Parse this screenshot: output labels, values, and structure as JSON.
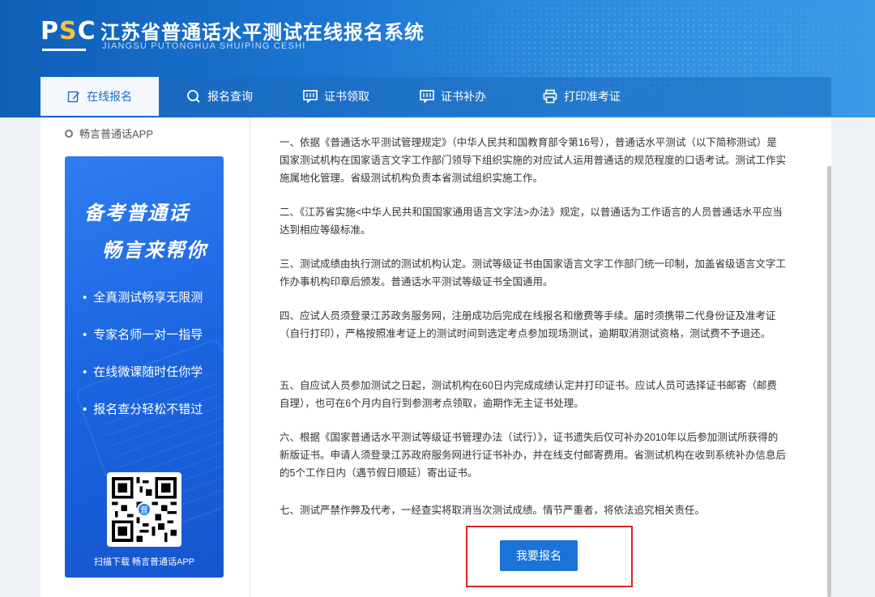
{
  "header": {
    "logo_text": "PSC",
    "title": "江苏省普通话水平测试在线报名系统",
    "subtitle": "JIANGSU PUTONGHUA SHUIPING CESHI"
  },
  "nav": {
    "items": [
      {
        "label": "在线报名",
        "icon": "edit-icon",
        "active": true
      },
      {
        "label": "报名查询",
        "icon": "search-icon",
        "active": false
      },
      {
        "label": "证书领取",
        "icon": "message-icon",
        "active": false
      },
      {
        "label": "证书补办",
        "icon": "message-icon",
        "active": false
      },
      {
        "label": "打印准考证",
        "icon": "printer-icon",
        "active": false
      }
    ]
  },
  "sidebar": {
    "title": "畅言普通话APP",
    "promo": {
      "heading1": "备考普通话",
      "heading2": "畅言来帮你",
      "features": [
        "全真测试畅享无限测",
        "专家名师一对一指导",
        "在线微课随时任你学",
        "报名查分轻松不错过"
      ],
      "qr_badge": "普",
      "caption": "扫描下载 畅言普通话APP"
    }
  },
  "content": {
    "paragraphs": [
      "一、依据《普通话水平测试管理规定》（中华人民共和国教育部令第16号），普通话水平测试（以下简称测试）是国家测试机构在国家语言文字工作部门领导下组织实施的对应试人运用普通话的规范程度的口语考试。测试工作实施属地化管理。省级测试机构负责本省测试组织实施工作。",
      "二、《江苏省实施<中华人民共和国国家通用语言文字法>办法》规定，以普通话为工作语言的人员普通话水平应当达到相应等级标准。",
      "三、测试成绩由执行测试的测试机构认定。测试等级证书由国家语言文字工作部门统一印制，加盖省级语言文字工作办事机构印章后颁发。普通话水平测试等级证书全国通用。",
      "四、应试人员须登录江苏政务服务网，注册成功后完成在线报名和缴费等手续。届时须携带二代身份证及准考证（自行打印），严格按照准考证上的测试时间到选定考点参加现场测试，逾期取消测试资格，测试费不予退还。",
      "五、自应试人员参加测试之日起，测试机构在60日内完成成绩认定并打印证书。应试人员可选择证书邮寄（邮费自理），也可在6个月内自行到参测考点领取，逾期作无主证书处理。",
      "六、根据《国家普通话水平测试等级证书管理办法（试行）》，证书遗失后仅可补办2010年以后参加测试所获得的新版证书。申请人须登录江苏政府服务网进行证书补办，并在线支付邮寄费用。省测试机构在收到系统补办信息后的5个工作日内（遇节假日顺延）寄出证书。",
      "七、测试严禁作弊及代考，一经查实将取消当次测试成绩。情节严重者，将依法追究相关责任。"
    ],
    "apply_button": "我要报名"
  },
  "colors": {
    "brand_blue": "#1b72d9",
    "highlight_red": "#d9262a",
    "promo_blue": "#1f68e2"
  }
}
